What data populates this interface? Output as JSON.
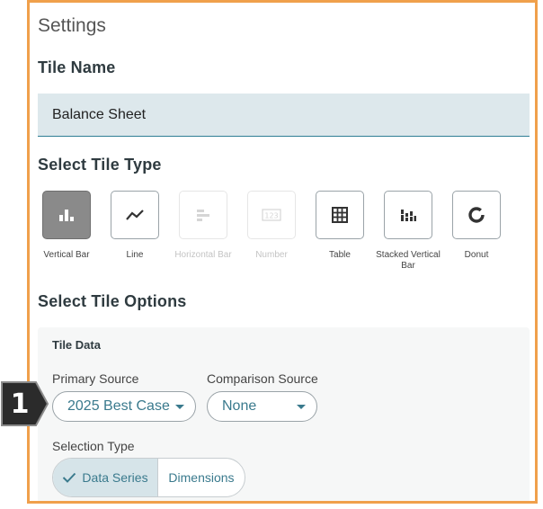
{
  "panel": {
    "title": "Settings"
  },
  "tile_name": {
    "heading": "Tile Name",
    "value": "Balance Sheet"
  },
  "tile_type": {
    "heading": "Select Tile Type",
    "types": [
      {
        "label": "Vertical Bar",
        "icon": "vertical-bar-icon",
        "state": "selected"
      },
      {
        "label": "Line",
        "icon": "line-chart-icon",
        "state": "enabled"
      },
      {
        "label": "Horizontal Bar",
        "icon": "horizontal-bar-icon",
        "state": "disabled"
      },
      {
        "label": "Number",
        "icon": "number-icon",
        "state": "disabled"
      },
      {
        "label": "Table",
        "icon": "table-icon",
        "state": "enabled"
      },
      {
        "label": "Stacked Vertical Bar",
        "icon": "stacked-bar-icon",
        "state": "enabled"
      },
      {
        "label": "Donut",
        "icon": "donut-icon",
        "state": "enabled"
      }
    ]
  },
  "tile_options": {
    "heading": "Select Tile Options",
    "card_title": "Tile Data",
    "primary_source": {
      "label": "Primary Source",
      "value": "2025 Best Case"
    },
    "comparison_source": {
      "label": "Comparison Source",
      "value": "None"
    },
    "selection_type": {
      "label": "Selection Type",
      "options": [
        "Data Series",
        "Dimensions"
      ],
      "selected": "Data Series"
    }
  },
  "step_badge": {
    "number": "1"
  },
  "colors": {
    "accent": "#3a7a8d",
    "frame": "#f0a04b",
    "badge": "#2b2b2b"
  }
}
